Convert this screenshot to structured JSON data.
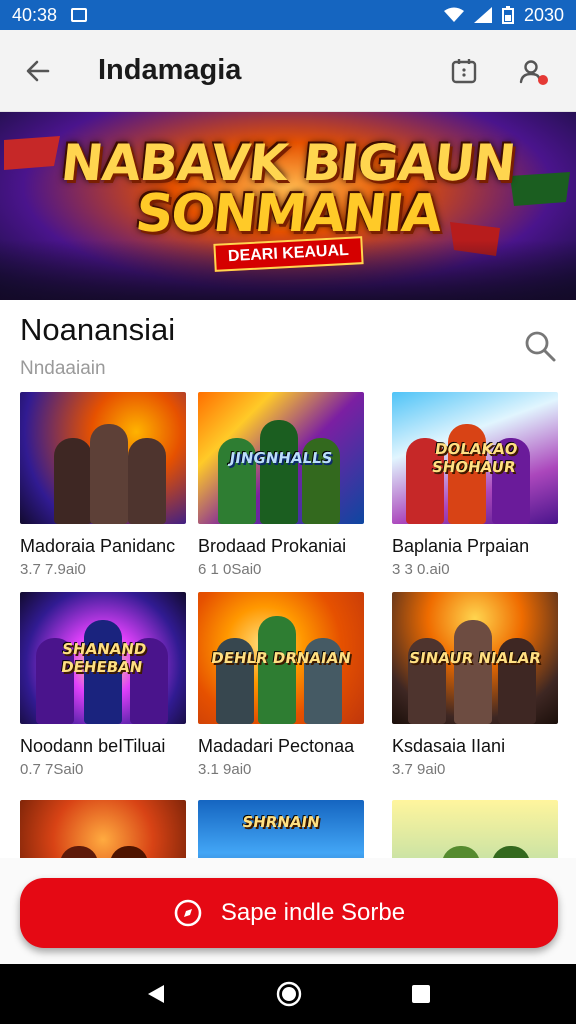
{
  "status_bar": {
    "time": "40:38",
    "right_text": "2030"
  },
  "app_bar": {
    "title": "Indamagia"
  },
  "banner": {
    "line1": "NABAVK BIGAUN",
    "line2": "SONMANIA",
    "tag": "DEARI KEAUAL"
  },
  "section": {
    "title": "Noanansiai",
    "subtitle": "Nndaaiain"
  },
  "cards": [
    {
      "name": "Madoraia Panidanc",
      "meta": "3.7 7.9ai0",
      "thumb_text": ""
    },
    {
      "name": "Brodaad Prokaniai",
      "meta": "6 1 0Sai0",
      "thumb_text": "JINGNHALLS"
    },
    {
      "name": "Baplania Prpaian",
      "meta": "3 3 0.ai0",
      "thumb_text": "DOLAKAO SHOHAUR"
    },
    {
      "name": "Noodann beITiluai",
      "meta": "0.7 7Sai0",
      "thumb_text": "SHANAND DEHEBAN"
    },
    {
      "name": "Madadari Pectonaa",
      "meta": "3.1 9ai0",
      "thumb_text": "DEHLR DRNAIAN"
    },
    {
      "name": "Ksdasaia IIani",
      "meta": "3.7 9ai0",
      "thumb_text": "SINAUR NIALAR"
    },
    {
      "name": "",
      "meta": "",
      "thumb_text": ""
    },
    {
      "name": "",
      "meta": "",
      "thumb_text": "SHRNAIN"
    },
    {
      "name": "",
      "meta": "",
      "thumb_text": ""
    }
  ],
  "cta": {
    "label": "Sape indle Sorbe"
  },
  "icons": {
    "back": "arrow-left-icon",
    "calendar": "calendar-icon",
    "profile": "profile-icon",
    "search": "search-icon",
    "compass": "compass-icon",
    "nav_back": "triangle-back-icon",
    "nav_home": "circle-home-icon",
    "nav_recent": "square-recents-icon"
  },
  "colors": {
    "status_bar": "#1565c0",
    "cta": "#e50914",
    "notification_dot": "#e53935"
  }
}
